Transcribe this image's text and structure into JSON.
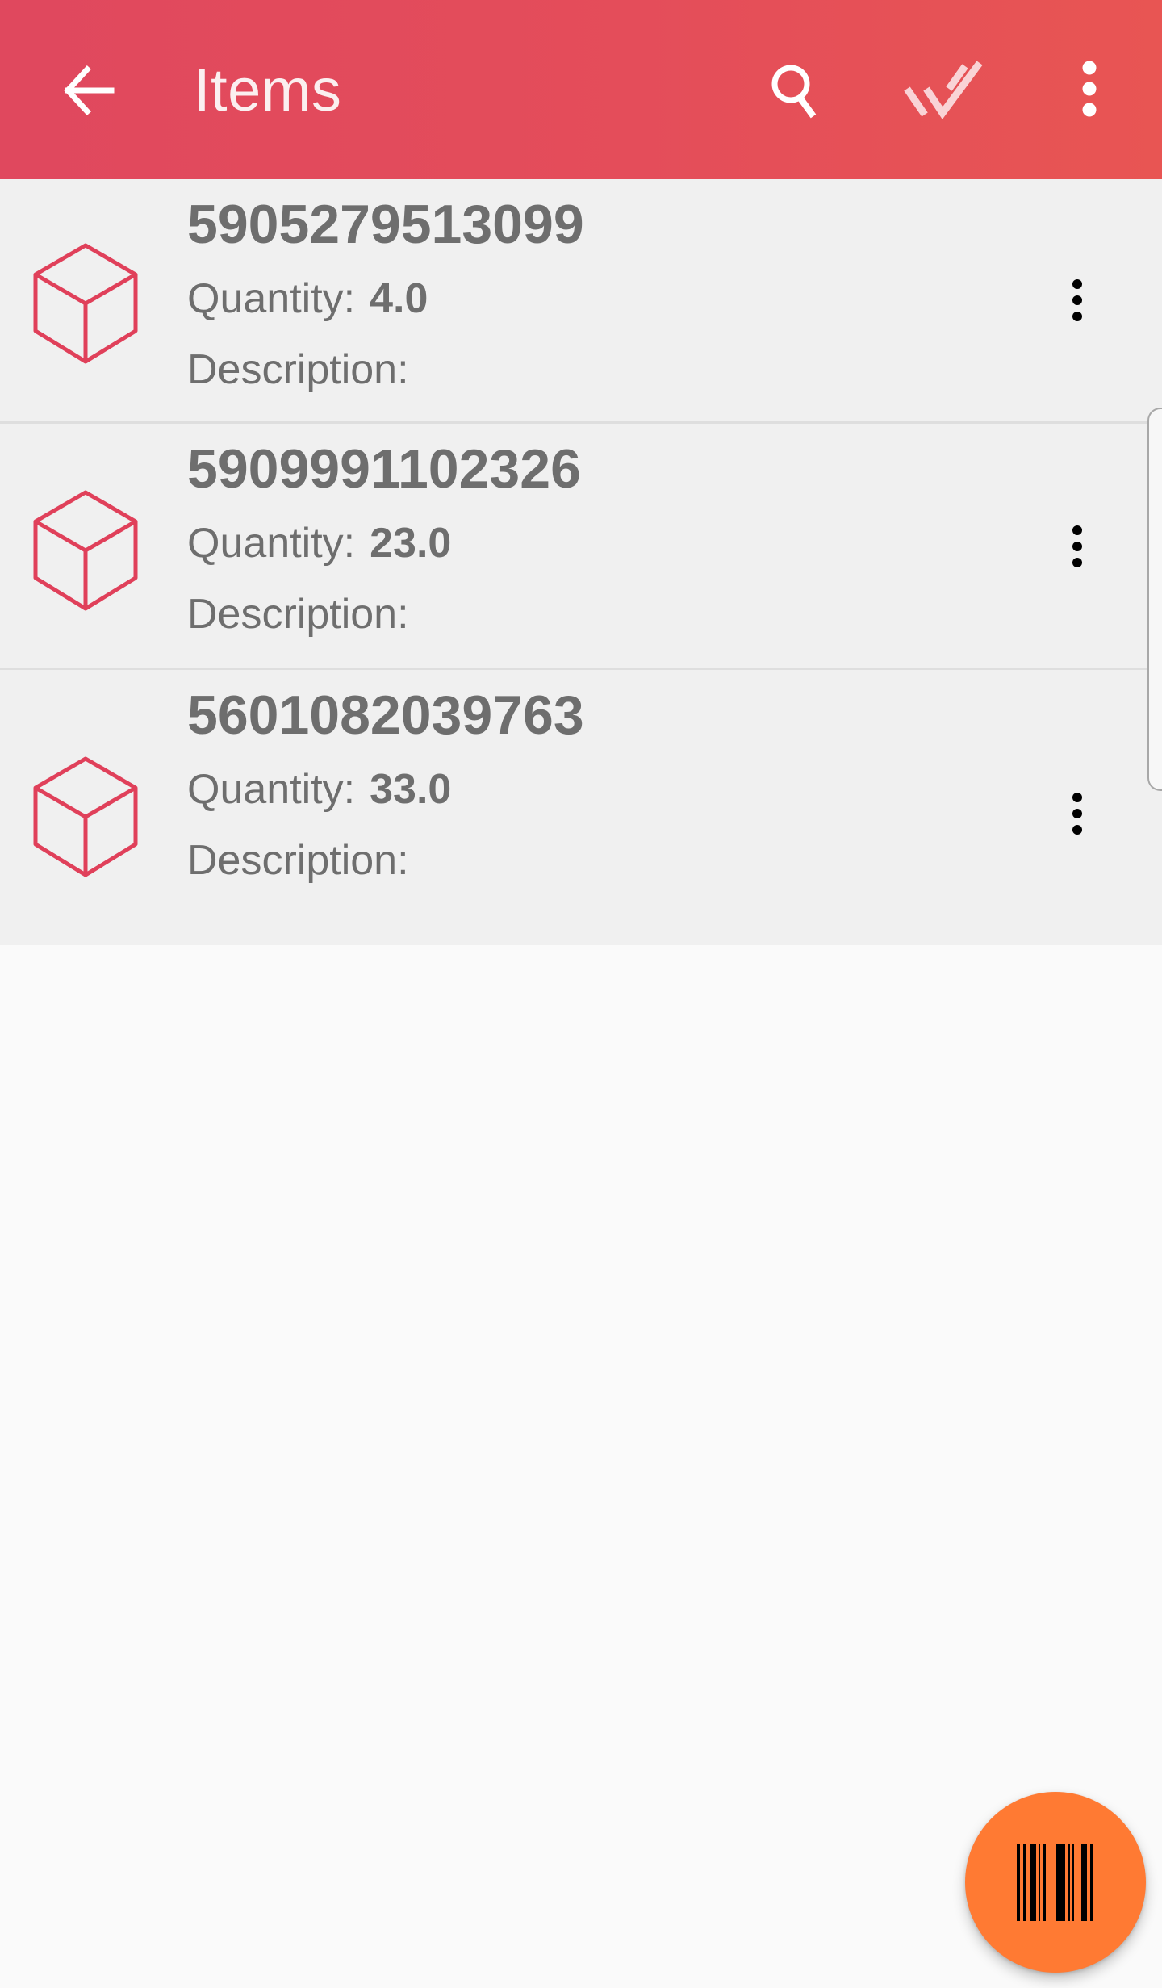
{
  "appbar": {
    "title": "Items",
    "actions": [
      {
        "icon": "back-arrow-icon"
      },
      {
        "icon": "search-icon"
      },
      {
        "icon": "double-check-icon"
      },
      {
        "icon": "more-vert-icon"
      }
    ]
  },
  "items": [
    {
      "barcode": "5905279513099",
      "quantity_label": "Quantity:",
      "quantity": "4.0",
      "description_label": "Description:",
      "description": ""
    },
    {
      "barcode": "5909991102326",
      "quantity_label": "Quantity:",
      "quantity": "23.0",
      "description_label": "Description:",
      "description": ""
    },
    {
      "barcode": "5601082039763",
      "quantity_label": "Quantity:",
      "quantity": "33.0",
      "description_label": "Description:",
      "description": ""
    }
  ],
  "fab": {
    "icon": "barcode-scan-icon"
  },
  "colors": {
    "appbar": "#E24E5C",
    "cube_icon": "#E0405A",
    "fab": "#FF7A33",
    "list_bg": "#F0F0F0",
    "text": "#6E6E6E"
  }
}
